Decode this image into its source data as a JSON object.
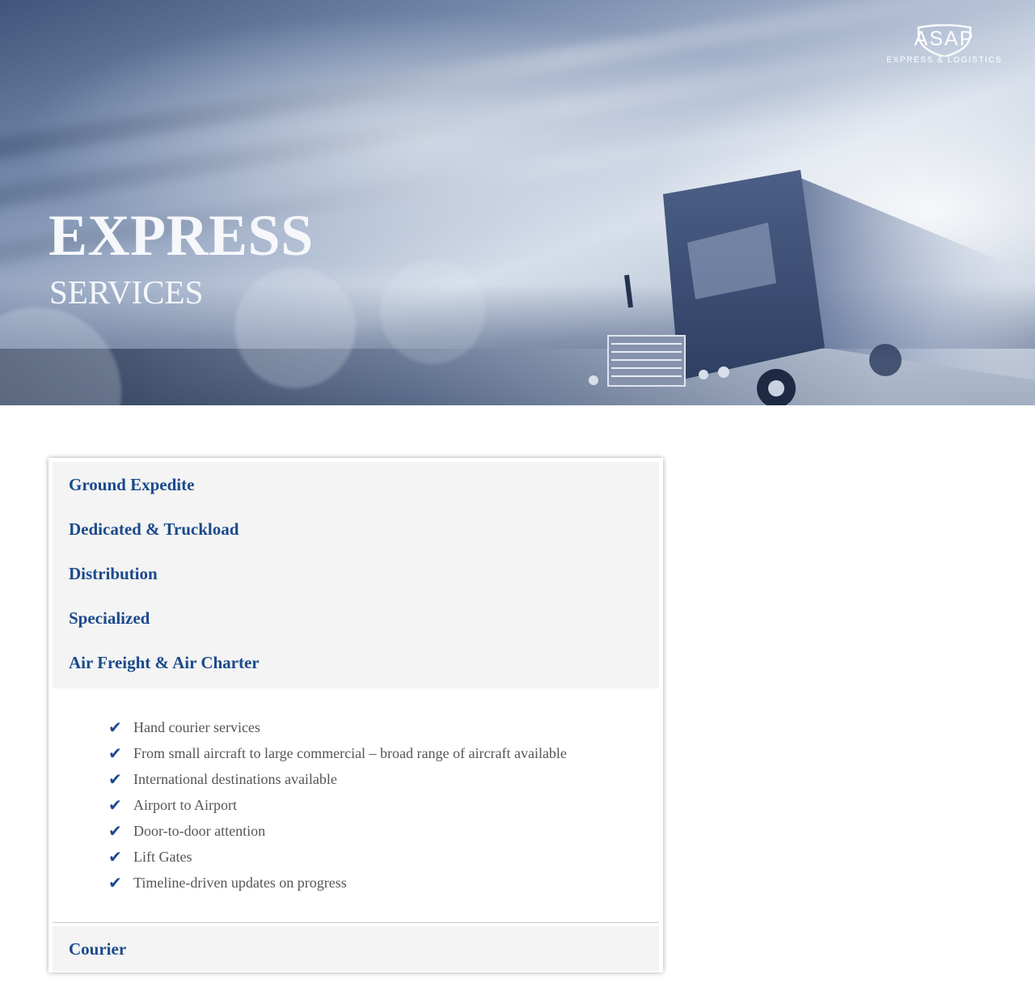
{
  "hero": {
    "title": "EXPRESS",
    "subtitle": "SERVICES"
  },
  "logo": {
    "wordmark": "ASAP",
    "tagline": "EXPRESS & LOGISTICS",
    "icon": "shield-icon"
  },
  "services": {
    "items": [
      {
        "label": "Ground Expedite",
        "expanded": false
      },
      {
        "label": "Dedicated & Truckload",
        "expanded": false
      },
      {
        "label": "Distribution",
        "expanded": false
      },
      {
        "label": "Specialized",
        "expanded": false
      },
      {
        "label": "Air Freight & Air Charter",
        "expanded": true
      },
      {
        "label": "Courier",
        "expanded": false
      }
    ],
    "expanded_features": [
      "Hand courier services",
      "From small aircraft to large commercial – broad range of aircraft available",
      "International destinations available",
      "Airport to Airport",
      "Door-to-door attention",
      "Lift Gates",
      "Timeline-driven updates on progress"
    ],
    "check_glyph": "✔",
    "check_icon": "checkmark-icon"
  },
  "colors": {
    "accent": "#1b4a8c",
    "panel_bg": "#f4f4f4",
    "body_text": "#555555",
    "hero_text": "#f5f7fb"
  }
}
